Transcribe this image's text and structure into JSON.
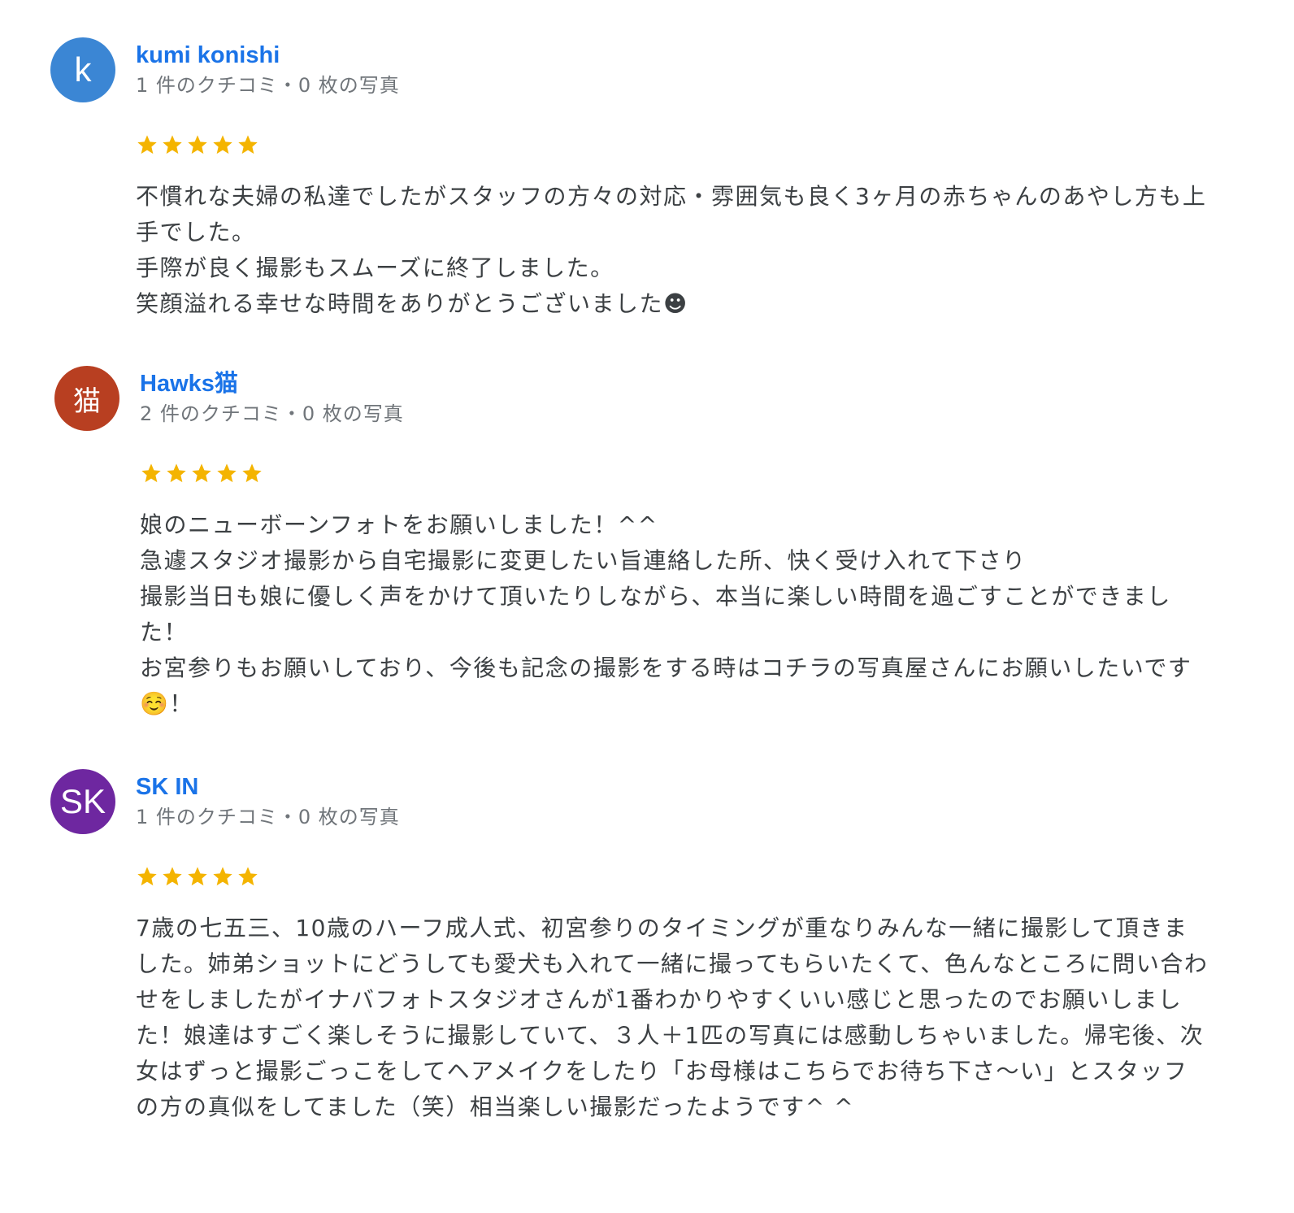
{
  "reviews": [
    {
      "author": "kumi konishi",
      "avatar_text": "k",
      "avatar_color": "#3b86d4",
      "meta": "1 件のクチコミ・0 枚の写真",
      "rating": 5,
      "text": "不慣れな夫婦の私達でしたがスタッフの方々の対応・雰囲気も良く3ヶ月の赤ちゃんのあやし方も上手でした。\n手際が良く撮影もスムーズに終了しました。\n笑顔溢れる幸せな時間をありがとうございました☻"
    },
    {
      "author": "Hawks猫",
      "avatar_text": "猫",
      "avatar_color": "#b83f21",
      "meta": "2 件のクチコミ・0 枚の写真",
      "rating": 5,
      "text": "娘のニューボーンフォトをお願いしました！^^\n急遽スタジオ撮影から自宅撮影に変更したい旨連絡した所、快く受け入れて下さり\n撮影当日も娘に優しく声をかけて頂いたりしながら、本当に楽しい時間を過ごすことができました！\nお宮参りもお願いしており、今後も記念の撮影をする時はコチラの写真屋さんにお願いしたいです☺️！"
    },
    {
      "author": "SK IN",
      "avatar_text": "SK",
      "avatar_color": "#6e27a0",
      "meta": "1 件のクチコミ・0 枚の写真",
      "rating": 5,
      "text": "7歳の七五三、10歳のハーフ成人式、初宮参りのタイミングが重なりみんな一緒に撮影して頂きました。姉弟ショットにどうしても愛犬も入れて一緒に撮ってもらいたくて、色んなところに問い合わせをしましたがイナバフォトスタジオさんが1番わかりやすくいい感じと思ったのでお願いしました！娘達はすごく楽しそうに撮影していて、３人＋1匹の写真には感動しちゃいました。帰宅後、次女はずっと撮影ごっこをしてヘアメイクをしたり「お母様はこちらでお待ち下さ〜い」とスタッフの方の真似をしてました（笑）相当楽しい撮影だったようです^ ^"
    }
  ],
  "colors": {
    "author": "#1a73e8",
    "meta": "#70757a",
    "text": "#3c4043",
    "star": "#f4b400"
  },
  "icons": {
    "star": "star-filled-icon"
  }
}
